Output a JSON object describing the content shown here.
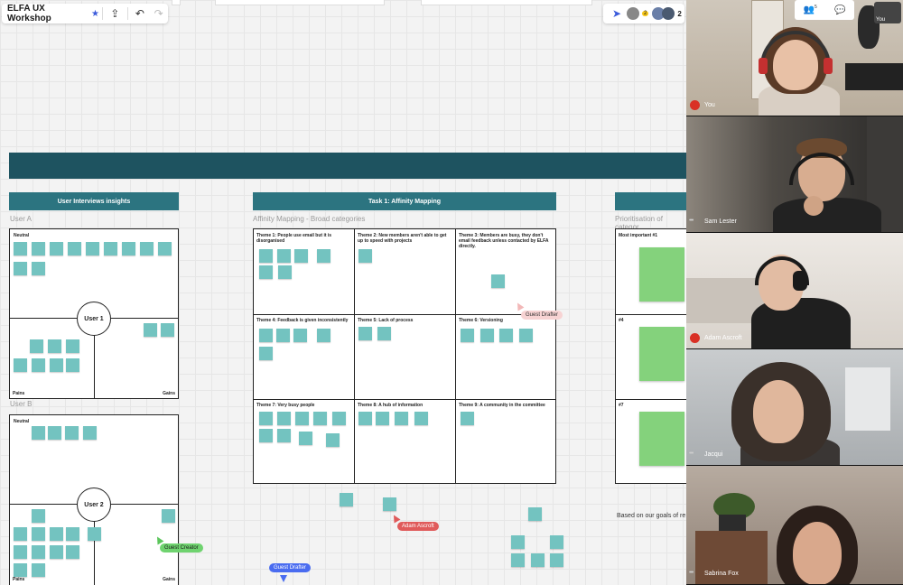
{
  "toolbar": {
    "board_title": "ELFA UX Workshop",
    "star_icon": "star-icon",
    "share_icon": "upload-icon",
    "undo_icon": "undo-icon",
    "redo_icon": "redo-icon"
  },
  "collab": {
    "viewer_count": "2",
    "participant_count": "2"
  },
  "sections": {
    "insights": {
      "title": "User Interviews insights",
      "user_a": "User A",
      "user_b": "User B",
      "neutral": "Neutral",
      "pains": "Pains",
      "gains": "Gains",
      "user1": "User 1",
      "user2": "User 2"
    },
    "affinity": {
      "title": "Task 1: Affinity Mapping",
      "subtitle": "Affinity Mapping - Broad categories",
      "themes": [
        "Theme 1: People use email but it is disorganised",
        "Theme 2: New members aren't able to get up to speed with projects",
        "Theme 3: Members are busy, they don't email feedback unless contacted by ELFA directly.",
        "Theme 4: Feedback is given inconsistently",
        "Theme 5: Lack of process",
        "Theme 6: Versioning",
        "Theme 7: Very busy people",
        "Theme 8: A hub of information",
        "Theme 9: A community in the committee"
      ]
    },
    "prioritisation": {
      "subtitle": "Prioritisation of categor",
      "most_important": "Most important #1",
      "rank4": "#4",
      "rank7": "#7",
      "note": "Based on our goals of re"
    }
  },
  "cursors": {
    "guest_drafter_1": "Guest Drafter",
    "adam": "Adam Ascroft",
    "guest_creator": "Guest Creator",
    "guest_drafter_2": "Guest Drafter"
  },
  "video": {
    "self_label": "You",
    "corner_label": "You",
    "people_count": "5",
    "participants": [
      {
        "name": "You",
        "muted": true
      },
      {
        "name": "Sam Lester",
        "muted": false
      },
      {
        "name": "Adam Ascroft",
        "muted": true
      },
      {
        "name": "Jacqui",
        "muted": false
      },
      {
        "name": "Sabrina Fox",
        "muted": false
      }
    ]
  },
  "colors": {
    "banner": "#1e5360",
    "header": "#2c7480",
    "sticky_teal": "#73c3c0",
    "sticky_green": "#84d27c",
    "accent_blue": "#3b5bdb"
  }
}
